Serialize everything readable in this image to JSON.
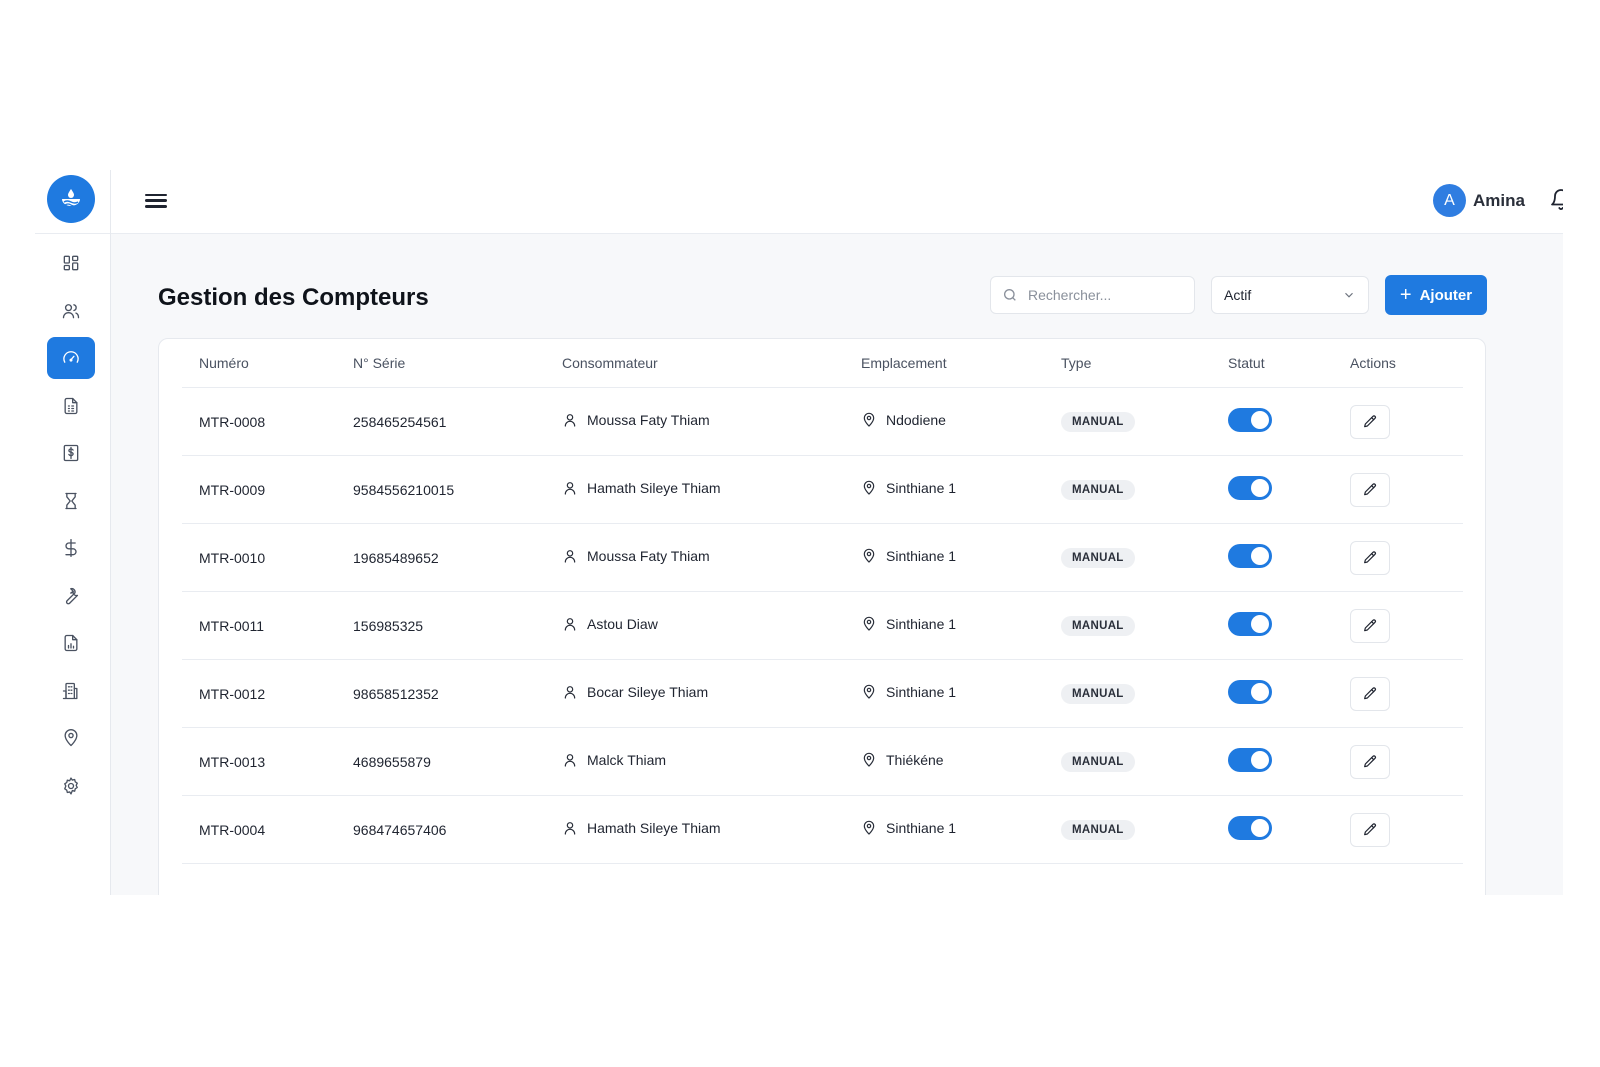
{
  "topbar": {
    "user_initial": "A",
    "user_name": "Amina"
  },
  "page": {
    "title": "Gestion des Compteurs"
  },
  "toolbar": {
    "search_placeholder": "Rechercher...",
    "status_filter": "Actif",
    "add_label": "Ajouter"
  },
  "sidebar": {
    "items": [
      {
        "icon": "dashboard-icon",
        "active": false
      },
      {
        "icon": "users-icon",
        "active": false
      },
      {
        "icon": "meter-gauge-icon",
        "active": true
      },
      {
        "icon": "invoice-icon",
        "active": false
      },
      {
        "icon": "bill-dollar-icon",
        "active": false
      },
      {
        "icon": "hourglass-icon",
        "active": false
      },
      {
        "icon": "dollar-icon",
        "active": false
      },
      {
        "icon": "wrench-icon",
        "active": false
      },
      {
        "icon": "report-icon",
        "active": false
      },
      {
        "icon": "building-icon",
        "active": false
      },
      {
        "icon": "location-icon",
        "active": false
      },
      {
        "icon": "settings-icon",
        "active": false
      }
    ]
  },
  "table": {
    "headers": {
      "numero": "Numéro",
      "serie": "N° Série",
      "consommateur": "Consommateur",
      "emplacement": "Emplacement",
      "type": "Type",
      "statut": "Statut",
      "actions": "Actions"
    },
    "rows": [
      {
        "numero": "MTR-0008",
        "serie": "258465254561",
        "consommateur": "Moussa Faty Thiam",
        "emplacement": "Ndodiene",
        "type": "MANUAL",
        "active": true
      },
      {
        "numero": "MTR-0009",
        "serie": "9584556210015",
        "consommateur": "Hamath Sileye Thiam",
        "emplacement": "Sinthiane 1",
        "type": "MANUAL",
        "active": true
      },
      {
        "numero": "MTR-0010",
        "serie": "19685489652",
        "consommateur": "Moussa Faty Thiam",
        "emplacement": "Sinthiane 1",
        "type": "MANUAL",
        "active": true
      },
      {
        "numero": "MTR-0011",
        "serie": "156985325",
        "consommateur": "Astou Diaw",
        "emplacement": "Sinthiane 1",
        "type": "MANUAL",
        "active": true
      },
      {
        "numero": "MTR-0012",
        "serie": "98658512352",
        "consommateur": "Bocar Sileye Thiam",
        "emplacement": "Sinthiane 1",
        "type": "MANUAL",
        "active": true
      },
      {
        "numero": "MTR-0013",
        "serie": "4689655879",
        "consommateur": "Malck Thiam",
        "emplacement": "Thiékéne",
        "type": "MANUAL",
        "active": true
      },
      {
        "numero": "MTR-0004",
        "serie": "968474657406",
        "consommateur": "Hamath Sileye Thiam",
        "emplacement": "Sinthiane 1",
        "type": "MANUAL",
        "active": true
      }
    ]
  },
  "colors": {
    "accent": "#1f7ae0",
    "badge_bg": "#eef0f3"
  }
}
